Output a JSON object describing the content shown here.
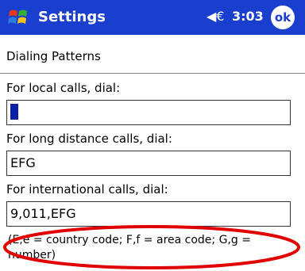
{
  "titlebar": {
    "app_title": "Settings",
    "time": "3:03",
    "ok_label": "ok",
    "speaker_icon": "◀€"
  },
  "page": {
    "subtitle": "Dialing Patterns"
  },
  "fields": {
    "local_label": "For local calls, dial:",
    "local_value": "",
    "long_label": "For long distance calls, dial:",
    "long_value": "EFG",
    "intl_label": "For international calls, dial:",
    "intl_value": "9,011,EFG"
  },
  "note": "(E,e = country code; F,f = area code; G,g = number)",
  "colors": {
    "titlebar": "#1a3fcf",
    "highlight_circle": "#e00000"
  }
}
